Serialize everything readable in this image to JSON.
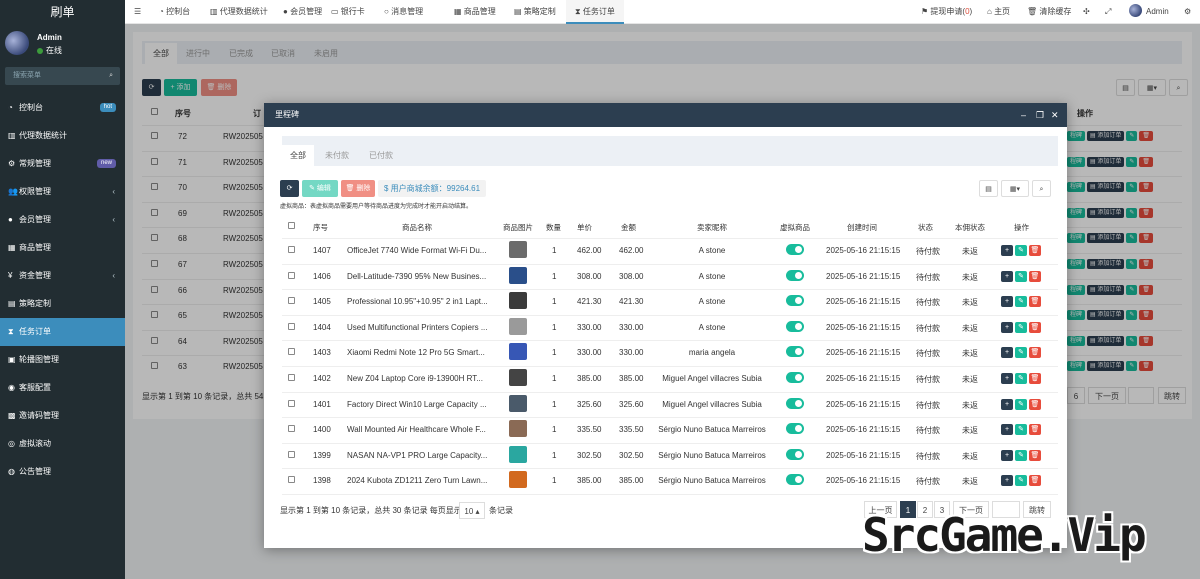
{
  "app": {
    "brand": "刷单",
    "user_name": "Admin",
    "user_status": "在线",
    "search_placeholder": "搜索菜单"
  },
  "sidebar": {
    "items": [
      {
        "icon": "dashboard-icon",
        "glyph": "◔",
        "label": "控制台",
        "badge": "hot",
        "badge_color": "#3c8dbc"
      },
      {
        "icon": "chart-icon",
        "glyph": "▥",
        "label": "代理数据统计"
      },
      {
        "icon": "gear-icon",
        "glyph": "⚙",
        "label": "常规管理",
        "badge": "new",
        "badge_color": "#605ca8"
      },
      {
        "icon": "users-icon",
        "glyph": "👥",
        "label": "权限管理",
        "caret": "‹"
      },
      {
        "icon": "user-icon",
        "glyph": "●",
        "label": "会员管理",
        "caret": "‹"
      },
      {
        "icon": "goods-icon",
        "glyph": "▦",
        "label": "商品管理"
      },
      {
        "icon": "yen-icon",
        "glyph": "¥",
        "label": "资金管理",
        "caret": "‹"
      },
      {
        "icon": "strategy-icon",
        "glyph": "▤",
        "label": "策略定制"
      },
      {
        "icon": "hourglass-icon",
        "glyph": "⧗",
        "label": "任务订单",
        "active": true
      },
      {
        "icon": "carousel-icon",
        "glyph": "▣",
        "label": "轮播图管理"
      },
      {
        "icon": "service-icon",
        "glyph": "◉",
        "label": "客服配置"
      },
      {
        "icon": "invite-icon",
        "glyph": "▩",
        "label": "邀请码管理"
      },
      {
        "icon": "scroll-icon",
        "glyph": "◎",
        "label": "虚拟滚动"
      },
      {
        "icon": "notice-icon",
        "glyph": "◍",
        "label": "公告管理"
      }
    ]
  },
  "topbar": {
    "tabs": [
      {
        "glyph": "◔",
        "label": "控制台"
      },
      {
        "glyph": "▥",
        "label": "代理数据统计"
      },
      {
        "glyph": "●",
        "label": "会员管理"
      },
      {
        "glyph": "▭",
        "label": "银行卡"
      },
      {
        "glyph": "○",
        "label": "消息管理"
      },
      {
        "glyph": "▦",
        "label": "商品管理"
      },
      {
        "glyph": "▤",
        "label": "策略定制"
      },
      {
        "glyph": "⧗",
        "label": "任务订单"
      }
    ],
    "withdraw_label": "提现申请(",
    "withdraw_count": "0",
    "withdraw_close": ")",
    "home_label": "主页",
    "clear_cache_label": "清除缓存",
    "user_label": "Admin"
  },
  "main": {
    "tabs": [
      "全部",
      "进行中",
      "已完成",
      "已取消",
      "未启用"
    ],
    "add_label": "添加",
    "delete_label": "删除",
    "col_seq": "序号",
    "col_order_prefix": "订",
    "col_ops": "操作",
    "rows": [
      {
        "id": "72",
        "order": "RW202505"
      },
      {
        "id": "71",
        "order": "RW202505"
      },
      {
        "id": "70",
        "order": "RW202505"
      },
      {
        "id": "69",
        "order": "RW202505"
      },
      {
        "id": "68",
        "order": "RW202505"
      },
      {
        "id": "67",
        "order": "RW202505"
      },
      {
        "id": "66",
        "order": "RW202505"
      },
      {
        "id": "65",
        "order": "RW202505"
      },
      {
        "id": "64",
        "order": "RW202505"
      },
      {
        "id": "63",
        "order": "RW202505"
      }
    ],
    "row_btn_milestone": "程碑",
    "row_btn_add_order": "添加订单",
    "footer_text": "显示第 1 到第 10 条记录，总共 54 条",
    "page_6": "6",
    "page_next": "下一页",
    "jump": "跳转"
  },
  "modal": {
    "title": "里程碑",
    "tabs": [
      "全部",
      "未付款",
      "已付款"
    ],
    "edit_label": "编辑",
    "delete_label": "删除",
    "balance_label": "$ 用户商城余额：99264.61",
    "note": "虚拟商品：表虚拟商品需要用户等待商品进度为完成时才能开启动结算。",
    "columns": [
      "序号",
      "商品名称",
      "商品图片",
      "数量",
      "单价",
      "金额",
      "卖家昵称",
      "虚拟商品",
      "创建时间",
      "状态",
      "本佣状态",
      "操作"
    ],
    "rows": [
      {
        "id": "1407",
        "name": "OfficeJet 7740 Wide Format Wi-Fi Du...",
        "qty": "1",
        "price": "462.00",
        "amount": "462.00",
        "seller": "A stone",
        "time": "2025-05-16 21:15:15",
        "status": "待付款",
        "comm": "未返",
        "thumb": "#6b6b6b"
      },
      {
        "id": "1406",
        "name": "Dell-Latitude-7390 95% New Busines...",
        "qty": "1",
        "price": "308.00",
        "amount": "308.00",
        "seller": "A stone",
        "time": "2025-05-16 21:15:15",
        "status": "待付款",
        "comm": "未返",
        "thumb": "#2a4f8a"
      },
      {
        "id": "1405",
        "name": "Professional 10.95\"+10.95\" 2 in1 Lapt...",
        "qty": "1",
        "price": "421.30",
        "amount": "421.30",
        "seller": "A stone",
        "time": "2025-05-16 21:15:15",
        "status": "待付款",
        "comm": "未返",
        "thumb": "#3b3b3b"
      },
      {
        "id": "1404",
        "name": "Used Multifunctional Printers Copiers ...",
        "qty": "1",
        "price": "330.00",
        "amount": "330.00",
        "seller": "A stone",
        "time": "2025-05-16 21:15:15",
        "status": "待付款",
        "comm": "未返",
        "thumb": "#9a9a9a"
      },
      {
        "id": "1403",
        "name": "Xiaomi Redmi Note 12 Pro 5G Smart...",
        "qty": "1",
        "price": "330.00",
        "amount": "330.00",
        "seller": "maria angela",
        "time": "2025-05-16 21:15:15",
        "status": "待付款",
        "comm": "未返",
        "thumb": "#3757b5"
      },
      {
        "id": "1402",
        "name": "New Z04 Laptop Core i9-13900H RT...",
        "qty": "1",
        "price": "385.00",
        "amount": "385.00",
        "seller": "Miguel Angel villacres Subia",
        "time": "2025-05-16 21:15:15",
        "status": "待付款",
        "comm": "未返",
        "thumb": "#444444"
      },
      {
        "id": "1401",
        "name": "Factory Direct Win10 Large Capacity ...",
        "qty": "1",
        "price": "325.60",
        "amount": "325.60",
        "seller": "Miguel Angel villacres Subia",
        "time": "2025-05-16 21:15:15",
        "status": "待付款",
        "comm": "未返",
        "thumb": "#4a5a6a"
      },
      {
        "id": "1400",
        "name": "Wall Mounted Air Healthcare Whole F...",
        "qty": "1",
        "price": "335.50",
        "amount": "335.50",
        "seller": "Sérgio Nuno Batuca Marreiros",
        "time": "2025-05-16 21:15:15",
        "status": "待付款",
        "comm": "未返",
        "thumb": "#8a6a55"
      },
      {
        "id": "1399",
        "name": "NASAN NA-VP1 PRO Large Capacity...",
        "qty": "1",
        "price": "302.50",
        "amount": "302.50",
        "seller": "Sérgio Nuno Batuca Marreiros",
        "time": "2025-05-16 21:15:15",
        "status": "待付款",
        "comm": "未返",
        "thumb": "#2aa7a0"
      },
      {
        "id": "1398",
        "name": "2024 Kubota ZD1211 Zero Turn Lawn...",
        "qty": "1",
        "price": "385.00",
        "amount": "385.00",
        "seller": "Sérgio Nuno Batuca Marreiros",
        "time": "2025-05-16 21:15:15",
        "status": "待付款",
        "comm": "未返",
        "thumb": "#d2691e"
      }
    ],
    "footer_text": "显示第 1 到第 10 条记录，总共 30 条记录 每页显示",
    "page_size": "10",
    "footer_suffix": "条记录",
    "prev": "上一页",
    "pages": [
      "1",
      "2",
      "3"
    ],
    "next": "下一页",
    "jump": "跳转"
  },
  "watermark": "SrcGame.Vip"
}
